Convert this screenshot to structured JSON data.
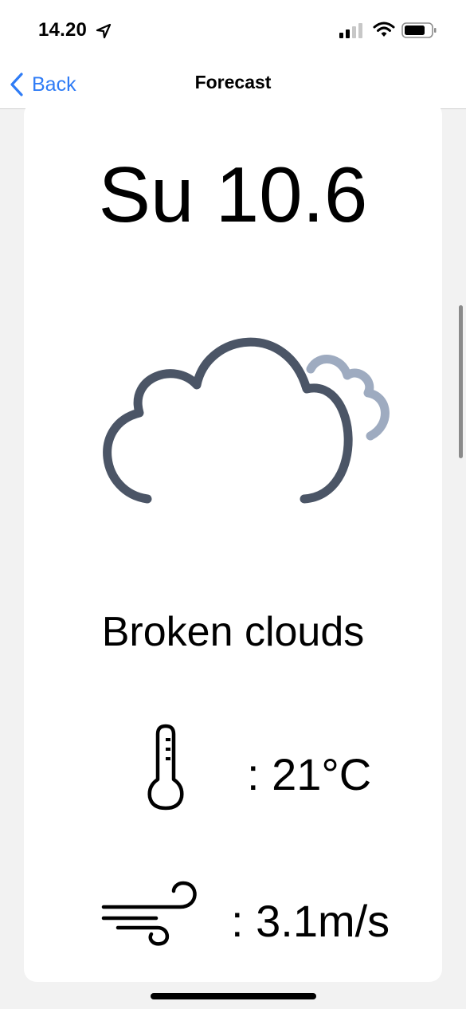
{
  "status_bar": {
    "time": "14.20"
  },
  "nav": {
    "back_label": "Back",
    "title": "Forecast"
  },
  "forecast": {
    "day": "Su 10.6",
    "description": "Broken clouds",
    "temperature": ": 21°C",
    "wind": ": 3.1m/s"
  },
  "icons": {
    "weather": "broken-clouds-icon",
    "temperature": "thermometer-icon",
    "wind": "wind-icon"
  },
  "colors": {
    "accent": "#2f7cf6",
    "cloud_front": "#4b5566",
    "cloud_back": "#9eabc0"
  }
}
